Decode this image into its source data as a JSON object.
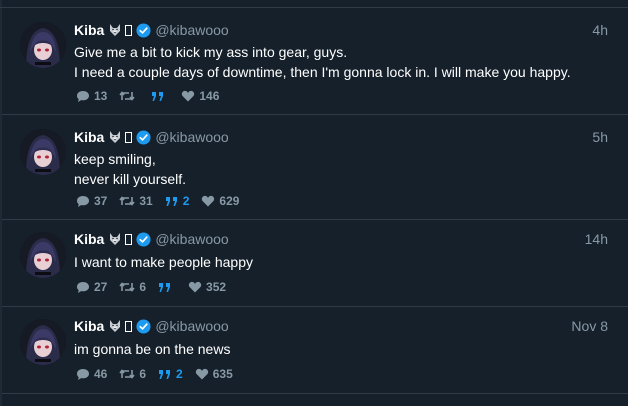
{
  "colors": {
    "background": "#15202b",
    "accent": "#1d9bf0",
    "muted": "#8899a6",
    "text": "#ffffff"
  },
  "tweets": [
    {
      "name": "Kiba",
      "emoji": "wolf-emoji",
      "handle": "@kibawooo",
      "time": "4h",
      "lines": [
        "Give me a bit to kick my ass into gear, guys.",
        "I need a couple days of downtime, then I'm gonna lock in. I will make you happy."
      ],
      "replies": "13",
      "retweets": "",
      "quotes": "",
      "likes": "146"
    },
    {
      "name": "Kiba",
      "emoji": "wolf-emoji",
      "handle": "@kibawooo",
      "time": "5h",
      "lines": [
        "keep smiling,",
        "never kill yourself."
      ],
      "replies": "37",
      "retweets": "31",
      "quotes": "2",
      "likes": "629"
    },
    {
      "name": "Kiba",
      "emoji": "wolf-emoji",
      "handle": "@kibawooo",
      "time": "14h",
      "lines": [
        "I want to make people happy"
      ],
      "replies": "27",
      "retweets": "6",
      "quotes": "",
      "likes": "352"
    },
    {
      "name": "Kiba",
      "emoji": "wolf-emoji",
      "handle": "@kibawooo",
      "time": "Nov 8",
      "lines": [
        "im gonna be on the news"
      ],
      "replies": "46",
      "retweets": "6",
      "quotes": "2",
      "likes": "635"
    }
  ]
}
